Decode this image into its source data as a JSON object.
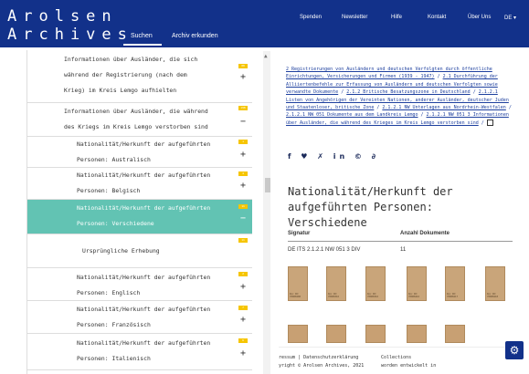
{
  "header": {
    "logo_line1": "Arolsen",
    "logo_line2": "Archives",
    "tabs": [
      {
        "label": "Suchen"
      },
      {
        "label": "Archiv erkunden"
      }
    ],
    "topnav": [
      {
        "label": "Spenden"
      },
      {
        "label": "Newsletter"
      },
      {
        "label": "Hilfe"
      },
      {
        "label": "Kontakt"
      },
      {
        "label": "Über Uns"
      },
      {
        "label": "DE"
      }
    ],
    "lang_arrow": "▾"
  },
  "tree": {
    "rows": [
      {
        "text": "Informationen über Ausländer, die sich während der Registrierung (nach dem Krieg) im Kreis Lemgo aufhielten",
        "badge": "88",
        "btn": "+"
      },
      {
        "text": "Informationen über Ausländer, die während des Kriegs im Kreis Lemgo verstorben sind",
        "badge": "198",
        "btn": "−"
      },
      {
        "text": "Nationalität/Herkunft der aufgeführten Personen: Australisch",
        "badge": "1",
        "btn": "+"
      },
      {
        "text": "Nationalität/Herkunft der aufgeführten Personen: Belgisch",
        "badge": "4",
        "btn": "+"
      },
      {
        "text": "Nationalität/Herkunft der aufgeführten Personen: Verschiedene",
        "badge": "11",
        "btn": "−"
      },
      {
        "text": "Ursprüngliche Erhebung",
        "badge": "11",
        "btn": ""
      },
      {
        "text": "Nationalität/Herkunft der aufgeführten Personen: Englisch",
        "badge": "2",
        "btn": "+"
      },
      {
        "text": "Nationalität/Herkunft der aufgeführten Personen: Französisch",
        "badge": "7",
        "btn": "+"
      },
      {
        "text": "Nationalität/Herkunft der aufgeführten Personen: Italienisch",
        "badge": "6",
        "btn": "+"
      }
    ]
  },
  "detail": {
    "breadcrumb": [
      "2 Registrierungen von Ausländern und deutschen Verfolgten durch öffentliche Einrichtungen, Versicherungen und Firmen (1939 - 1947)",
      "2.1 Durchführung der Alliiertenbefehle zur Erfassung von Ausländern und deutschen Verfolgten sowie verwandte Dokumente",
      "2.1.2 Britische Besatzungszone in Deutschland",
      "2.1.2.1 Listen von Angehörigen der Vereinten Nationen, anderer Ausländer, deutscher Juden und Staatenloser, britische Zone",
      "2.1.2.1 NW Unterlagen aus Nordrhein-Westfalen",
      "2.1.2.1 NW 051 Dokumente aus dem Landkreis Lemgo",
      "2.1.2.1 NW 051 3 Informationen über Ausländer, die während des Krieges im Kreis Lemgo verstorben sind"
    ],
    "share_icons": "f ♥ ✗ in © ∂",
    "title": "Nationalität/Herkunft der aufgeführten Personen: Verschiedene",
    "signatur_label": "Signatur",
    "signatur_value": "DE ITS 2.1.2.1 NW 051 3 DIV",
    "count_label": "Anzahl Dokumente",
    "count_value": "11",
    "thumbs": [
      {
        "label": "Doc ID: 70008200"
      },
      {
        "label": "Doc ID: 70008316"
      },
      {
        "label": "Doc ID: 70008316"
      },
      {
        "label": "Doc ID: 70008416"
      },
      {
        "label": "Doc ID: 70008417"
      },
      {
        "label": "Doc ID: 70008418"
      }
    ]
  },
  "footer": {
    "line1": "ressum  |  Datenschutzerklärung",
    "line2": "yright © Arolsen Archives, 2021",
    "line3": "Collections",
    "line4": "worden entwickelt in"
  },
  "colors": {
    "header": "#12318a",
    "selected": "#62c3b3",
    "badge": "#f6c500",
    "link": "#1d3f9e"
  }
}
